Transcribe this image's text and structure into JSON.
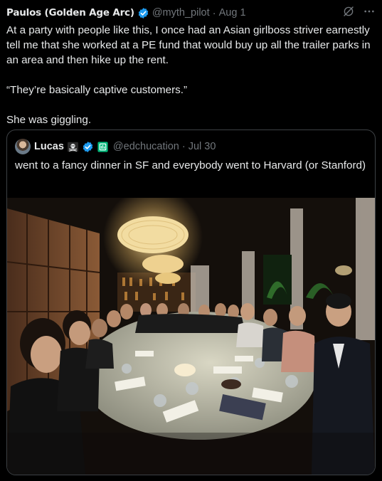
{
  "tweet": {
    "author_name": "Paulos (Golden Age Arc)",
    "handle": "@myth_pilot",
    "separator": "·",
    "date": "Aug 1",
    "paragraphs": [
      "At a party with people like this, I once had an Asian girlboss striver earnestly tell me that she worked at a PE fund that would buy up all the trailer parks in an area and then hike up the rent.",
      "“They’re basically captive customers.”",
      "She was giggling."
    ],
    "icons": [
      "verified-badge-icon",
      "grok-icon",
      "more-icon"
    ]
  },
  "quoted_tweet": {
    "author_name": "Lucas",
    "handle": "@edchucation",
    "separator": "·",
    "date": "Jul 30",
    "text": "went to a fancy dinner in SF and everybody went to Harvard (or Stanford)",
    "icons": [
      "skull-crossbones-icon",
      "verified-badge-icon",
      "affiliate-badge-icon"
    ]
  },
  "colors": {
    "background": "#000000",
    "text": "#e7e9ea",
    "muted": "#71767b",
    "verified_blue": "#1d9bf0",
    "affiliate_green": "#00ba7c",
    "border": "#3d4145"
  }
}
